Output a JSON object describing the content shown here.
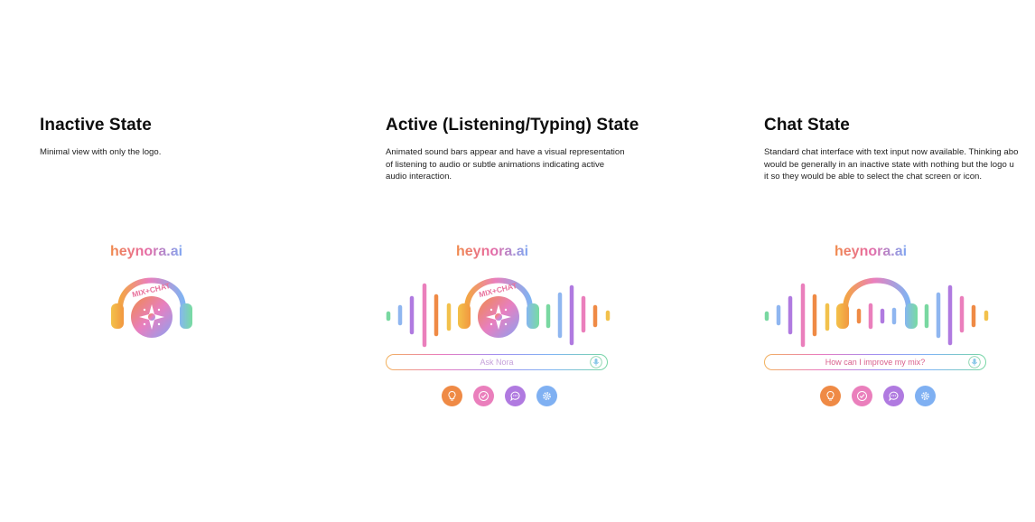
{
  "panels": {
    "inactive": {
      "title": "Inactive State",
      "description": "Minimal view with only the logo."
    },
    "active": {
      "title": "Active (Listening/Typing) State",
      "description": "Animated sound bars appear and have a visual representation of listening to audio or subtle animations indicating active audio interaction.",
      "input_placeholder": "Ask Nora"
    },
    "chat": {
      "title": "Chat State",
      "description_lines": [
        "Standard chat interface with text input now available. Thinking abo",
        "would be generally in an inactive state with nothing but the logo u",
        "it so they would be able to select the chat screen or icon."
      ],
      "input_value": "How can I improve my mix?"
    }
  },
  "brand": {
    "name": "heynora.ai",
    "badge_text": "MIX+CHAT"
  },
  "icons": {
    "mic": "microphone-icon",
    "actions": [
      "lightbulb-icon",
      "check-circle-icon",
      "chat-bubble-icon",
      "settings-gear-icon"
    ]
  },
  "colors": {
    "orange": "#ef8a45",
    "pink": "#ea7fbc",
    "purple": "#b07ae0",
    "blue": "#7fb0f2",
    "green": "#79d8a1",
    "yellow": "#f2c14c"
  }
}
